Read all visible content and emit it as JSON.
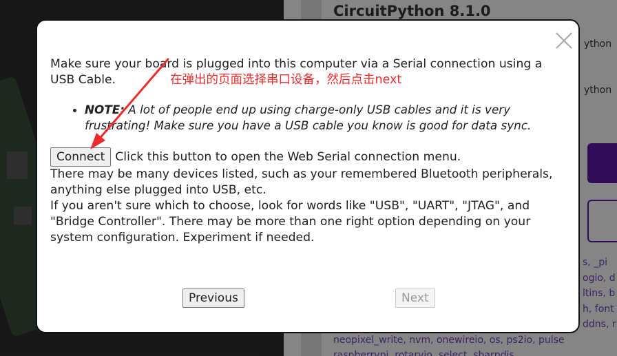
{
  "background": {
    "title": "CircuitPython 8.1.0",
    "side_texts": [
      "ython",
      "ython"
    ],
    "modules_lines": [
      "s, _pi",
      "ogio, d",
      "ltins, b",
      "h, font",
      "ddns, r",
      "neopixel_write, nvm, onewireio, os, ps2io, pulse",
      "raspberrypi, rotaryio, select, sharpdis"
    ]
  },
  "modal": {
    "intro": "Make sure your board is plugged into this computer via a Serial connection using a USB Cable.",
    "note_label": "NOTE:",
    "note_text": " A lot of people end up using charge-only USB cables and it is very frustrating! Make sure you have a USB cable you know is good for data sync.",
    "connect_label": "Connect",
    "connect_desc": "Click this button to open the Web Serial connection menu.",
    "devices_text": "There may be many devices listed, such as your remembered Bluetooth peripherals, anything else plugged into USB, etc.",
    "choose_text": "If you aren't sure which to choose, look for words like \"USB\", \"UART\", \"JTAG\", and \"Bridge Controller\". There may be more than one right option depending on your system configuration. Experiment if needed.",
    "previous_label": "Previous",
    "next_label": "Next"
  },
  "annotation": {
    "text": "在弹出的页面选择串口设备，然后点击next",
    "color": "#ef2a2a"
  },
  "icons": {
    "close": "close-icon",
    "arrow": "arrow-icon"
  }
}
